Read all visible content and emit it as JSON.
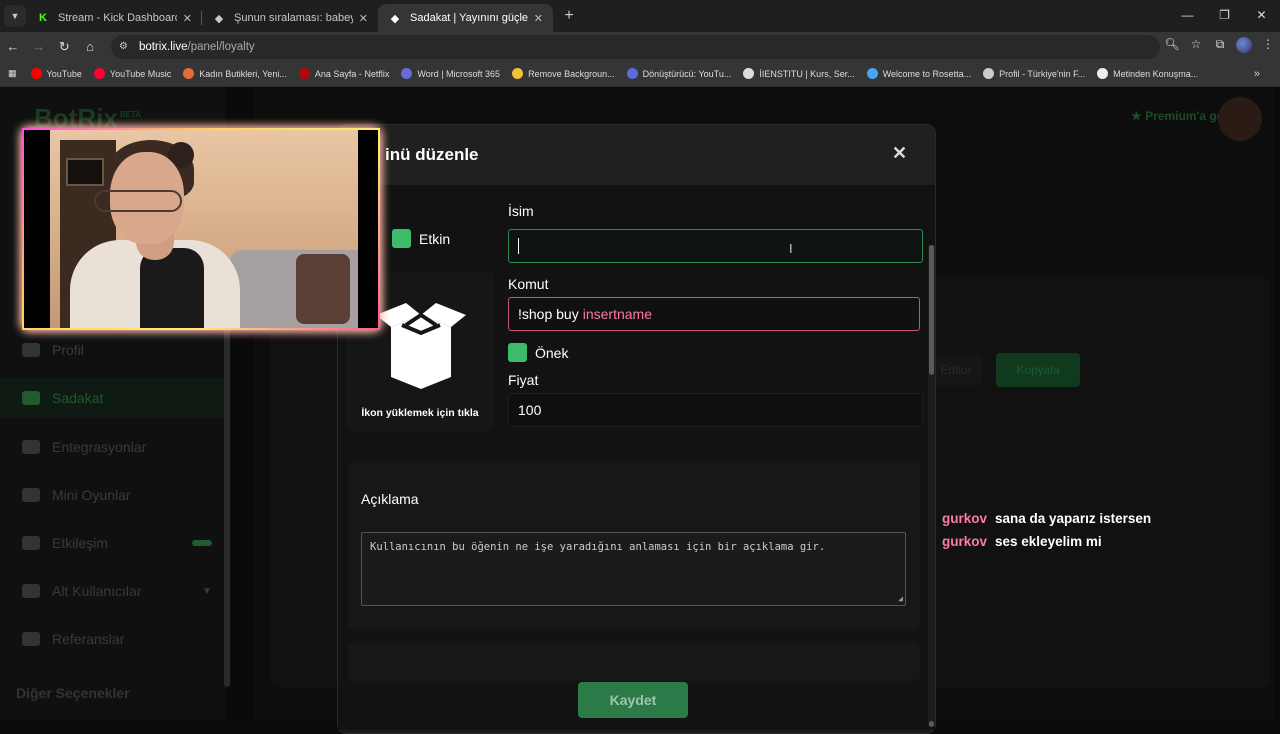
{
  "browser": {
    "tabs": [
      {
        "title": "Stream - Kick Dashboard",
        "favicon": "kick-icon",
        "active": false
      },
      {
        "title": "Şunun sıralaması: babeyzos | Yayı…",
        "favicon": "botrix-icon",
        "active": false
      },
      {
        "title": "Sadakat | Yayınını güçlendirmek…",
        "favicon": "botrix-icon",
        "active": true
      }
    ],
    "url_host": "botrix.live",
    "url_path": "/panel/loyalty",
    "bookmarks": [
      {
        "label": "YouTube",
        "color": "#ff0000"
      },
      {
        "label": "YouTube Music",
        "color": "#ff0033"
      },
      {
        "label": "Kadın Butikleri, Yeni...",
        "color": "#e66b3a"
      },
      {
        "label": "Ana Sayfa - Netflix",
        "color": "#b20710"
      },
      {
        "label": "Word | Microsoft 365",
        "color": "#6b6bd6"
      },
      {
        "label": "Remove Backgroun...",
        "color": "#f3c234"
      },
      {
        "label": "Dönüştürücü: YouTu...",
        "color": "#5b6bd8"
      },
      {
        "label": "İIENSTITU | Kurs, Ser...",
        "color": "#dddddd"
      },
      {
        "label": "Welcome to Rosetta...",
        "color": "#4aa3f0"
      },
      {
        "label": "Profil - Türkiye'nin F...",
        "color": "#cccccc"
      },
      {
        "label": "Metinden Konuşma...",
        "color": "#eeeeee"
      }
    ]
  },
  "background": {
    "logo": "BotRix",
    "logo_badge": "BETA",
    "premium": "Premium'a geç",
    "sidebar_items": [
      "Profil",
      "Sadakat",
      "Entegrasyonlar",
      "Mini Oyunlar",
      "Etkileşim",
      "Alt Kullanıcılar",
      "Referanslar"
    ],
    "sidebar_section": "Diğer Seçenekler",
    "btn_dark": "Editor",
    "btn_green": "Kopyala"
  },
  "chat": [
    {
      "user": "gurkov",
      "message": "sana da yaparız istersen"
    },
    {
      "user": "gurkov",
      "message": "ses ekleyelim mi"
    }
  ],
  "modal": {
    "title": "inü düzenle",
    "enabled_label": "Etkin",
    "icon_caption": "İkon yüklemek için tıkla",
    "name_label": "İsim",
    "name_value": "",
    "command_label": "Komut",
    "command_prefix": "!shop buy",
    "command_arg": "insertname",
    "prefix_label": "Önek",
    "price_label": "Fiyat",
    "price_value": "100",
    "description_title": "Açıklama",
    "description_placeholder": "Kullanıcının bu öğenin ne işe yaradığını anlaması için bir açıklama gir.",
    "save_label": "Kaydet"
  }
}
